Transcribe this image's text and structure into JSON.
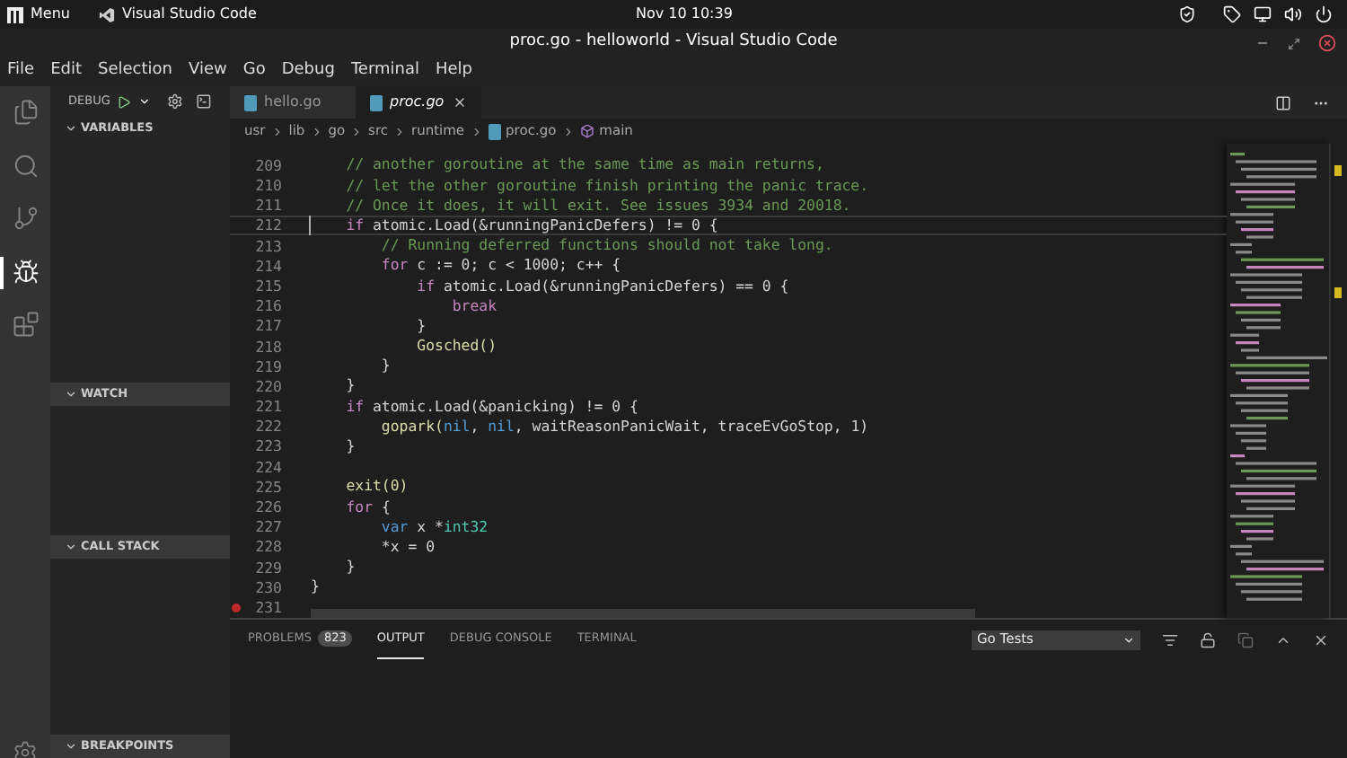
{
  "system_bar": {
    "menu_label": "Menu",
    "app_label": "Visual Studio Code",
    "clock": "Nov 10 10:39"
  },
  "window": {
    "title": "proc.go - helloworld - Visual Studio Code"
  },
  "menu_bar": [
    "File",
    "Edit",
    "Selection",
    "View",
    "Go",
    "Debug",
    "Terminal",
    "Help"
  ],
  "activity_bar": [
    {
      "kind": "files",
      "selected": false
    },
    {
      "kind": "search",
      "selected": false
    },
    {
      "kind": "git",
      "selected": false
    },
    {
      "kind": "debug",
      "selected": true
    },
    {
      "kind": "extensions",
      "selected": false
    }
  ],
  "debug_toolbar": {
    "label": "DEBUG"
  },
  "sidebar": {
    "sections": [
      {
        "title": "VARIABLES",
        "expanded": true
      },
      {
        "title": "WATCH",
        "expanded": true
      },
      {
        "title": "CALL STACK",
        "expanded": true
      },
      {
        "title": "BREAKPOINTS",
        "expanded": true
      }
    ]
  },
  "tabs": [
    {
      "label": "hello.go",
      "selected": false
    },
    {
      "label": "proc.go",
      "selected": true
    }
  ],
  "breadcrumbs": [
    {
      "label": "usr",
      "kind": "folder"
    },
    {
      "label": "lib",
      "kind": "folder"
    },
    {
      "label": "go",
      "kind": "folder"
    },
    {
      "label": "src",
      "kind": "folder"
    },
    {
      "label": "runtime",
      "kind": "folder"
    },
    {
      "label": "proc.go",
      "kind": "file"
    },
    {
      "label": "main",
      "kind": "symbol"
    }
  ],
  "editor": {
    "lines": [
      {
        "number": "209",
        "current": false,
        "breakpoint": false,
        "tokens": [
          {
            "t": "    // another goroutine at the same time as main returns,",
            "kind": "comment"
          }
        ]
      },
      {
        "number": "210",
        "current": false,
        "breakpoint": false,
        "tokens": [
          {
            "t": "    // let the other goroutine finish printing the panic trace.",
            "kind": "comment"
          }
        ]
      },
      {
        "number": "211",
        "current": false,
        "breakpoint": false,
        "tokens": [
          {
            "t": "    // Once it does, it will exit. See issues 3934 and 20018.",
            "kind": "comment"
          }
        ]
      },
      {
        "number": "212",
        "current": true,
        "breakpoint": false,
        "tokens": [
          {
            "t": "    if",
            "kind": "keyword"
          },
          {
            "t": " atomic.Load(&runningPanicDefers) != 0 {",
            "kind": "plain"
          }
        ]
      },
      {
        "number": "213",
        "current": false,
        "breakpoint": false,
        "tokens": [
          {
            "t": "        // Running deferred functions should not take long.",
            "kind": "comment"
          }
        ]
      },
      {
        "number": "214",
        "current": false,
        "breakpoint": false,
        "tokens": [
          {
            "t": "        for",
            "kind": "keyword"
          },
          {
            "t": " c := 0; c < 1000; c++ {",
            "kind": "plain"
          }
        ]
      },
      {
        "number": "215",
        "current": false,
        "breakpoint": false,
        "tokens": [
          {
            "t": "            if",
            "kind": "keyword"
          },
          {
            "t": " atomic.Load(&runningPanicDefers) == 0 {",
            "kind": "plain"
          }
        ]
      },
      {
        "number": "216",
        "current": false,
        "breakpoint": false,
        "tokens": [
          {
            "t": "                break",
            "kind": "keyword"
          }
        ]
      },
      {
        "number": "217",
        "current": false,
        "breakpoint": false,
        "tokens": [
          {
            "t": "            }",
            "kind": "plain"
          }
        ]
      },
      {
        "number": "218",
        "current": false,
        "breakpoint": false,
        "tokens": [
          {
            "t": "            Gosched()",
            "kind": "function"
          }
        ]
      },
      {
        "number": "219",
        "current": false,
        "breakpoint": false,
        "tokens": [
          {
            "t": "        }",
            "kind": "plain"
          }
        ]
      },
      {
        "number": "220",
        "current": false,
        "breakpoint": false,
        "tokens": [
          {
            "t": "    }",
            "kind": "plain"
          }
        ]
      },
      {
        "number": "221",
        "current": false,
        "breakpoint": false,
        "tokens": [
          {
            "t": "    if",
            "kind": "keyword"
          },
          {
            "t": " atomic.Load(&panicking) != 0 {",
            "kind": "plain"
          }
        ]
      },
      {
        "number": "222",
        "current": false,
        "breakpoint": false,
        "tokens": [
          {
            "t": "        gopark(",
            "kind": "function"
          },
          {
            "t": "nil",
            "kind": "constant"
          },
          {
            "t": ", ",
            "kind": "plain"
          },
          {
            "t": "nil",
            "kind": "constant"
          },
          {
            "t": ", waitReasonPanicWait, traceEvGoStop, 1)",
            "kind": "plain"
          }
        ]
      },
      {
        "number": "223",
        "current": false,
        "breakpoint": false,
        "tokens": [
          {
            "t": "    }",
            "kind": "plain"
          }
        ]
      },
      {
        "number": "224",
        "current": false,
        "breakpoint": false
      },
      {
        "number": "225",
        "current": false,
        "breakpoint": false,
        "tokens": [
          {
            "t": "    exit(0)",
            "kind": "function"
          }
        ]
      },
      {
        "number": "226",
        "current": false,
        "breakpoint": false,
        "tokens": [
          {
            "t": "    for",
            "kind": "keyword"
          },
          {
            "t": " {",
            "kind": "plain"
          }
        ]
      },
      {
        "number": "227",
        "current": false,
        "breakpoint": false,
        "tokens": [
          {
            "t": "        var",
            "kind": "constant"
          },
          {
            "t": " x *",
            "kind": "plain"
          },
          {
            "t": "int32",
            "kind": "type"
          }
        ]
      },
      {
        "number": "228",
        "current": false,
        "breakpoint": false,
        "tokens": [
          {
            "t": "        *x = 0",
            "kind": "plain"
          }
        ]
      },
      {
        "number": "229",
        "current": false,
        "breakpoint": false,
        "tokens": [
          {
            "t": "    }",
            "kind": "plain"
          }
        ]
      },
      {
        "number": "230",
        "current": false,
        "breakpoint": false,
        "tokens": [
          {
            "t": "}",
            "kind": "plain"
          }
        ]
      },
      {
        "number": "231",
        "current": false,
        "breakpoint": true
      }
    ]
  },
  "panel": {
    "tabs": [
      {
        "label": "PROBLEMS",
        "badge": "823",
        "selected": false
      },
      {
        "label": "OUTPUT",
        "selected": true
      },
      {
        "label": "DEBUG CONSOLE",
        "selected": false
      },
      {
        "label": "TERMINAL",
        "selected": false
      }
    ],
    "output_channel": "Go Tests"
  }
}
